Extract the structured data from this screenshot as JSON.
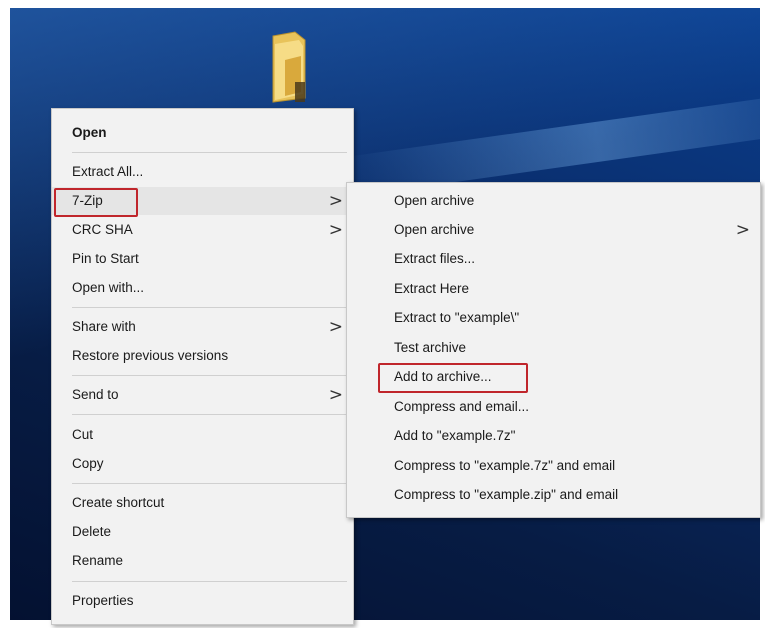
{
  "desktop": {
    "folder_icon": "folder-icon"
  },
  "context_menu": {
    "items": [
      {
        "label": "Open",
        "bold": true
      },
      {
        "label": "Extract All..."
      },
      {
        "label": "7-Zip",
        "has_submenu": true,
        "highlighted": true
      },
      {
        "label": "CRC SHA",
        "has_submenu": true
      },
      {
        "label": "Pin to Start"
      },
      {
        "label": "Open with..."
      },
      {
        "label": "Share with",
        "has_submenu": true
      },
      {
        "label": "Restore previous versions"
      },
      {
        "label": "Send to",
        "has_submenu": true
      },
      {
        "label": "Cut"
      },
      {
        "label": "Copy"
      },
      {
        "label": "Create shortcut"
      },
      {
        "label": "Delete"
      },
      {
        "label": "Rename"
      },
      {
        "label": "Properties"
      }
    ],
    "submenu_arrow": ">"
  },
  "submenu_7zip": {
    "items": [
      {
        "label": "Open archive"
      },
      {
        "label": "Open archive",
        "has_submenu": true
      },
      {
        "label": "Extract files..."
      },
      {
        "label": "Extract Here"
      },
      {
        "label": "Extract to \"example\\\""
      },
      {
        "label": "Test archive"
      },
      {
        "label": "Add to archive...",
        "highlighted": true
      },
      {
        "label": "Compress and email..."
      },
      {
        "label": "Add to \"example.7z\""
      },
      {
        "label": "Compress to \"example.7z\" and email"
      },
      {
        "label": "Compress to \"example.zip\" and email"
      }
    ]
  },
  "colors": {
    "highlight_box": "#c0262c",
    "menu_background": "#f2f2f2",
    "hover_background": "#e5e5e5"
  }
}
